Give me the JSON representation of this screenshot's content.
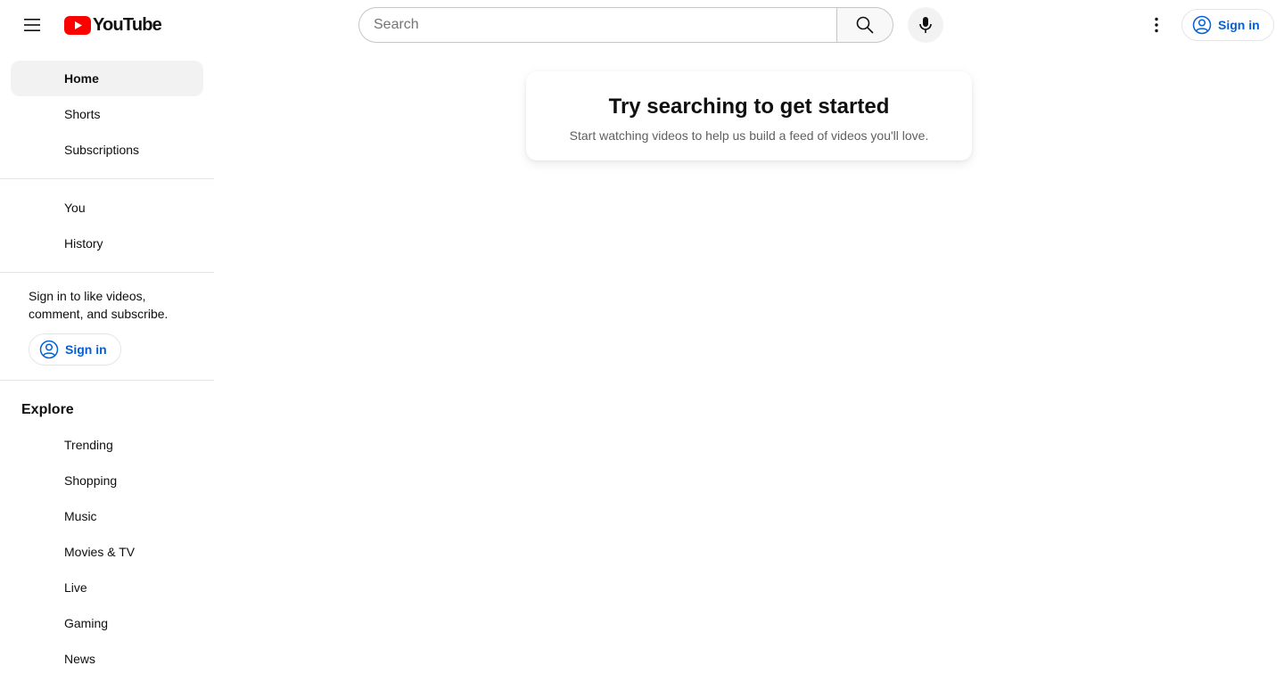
{
  "header": {
    "logo_text": "YouTube",
    "search_placeholder": "Search",
    "signin_label": "Sign in"
  },
  "sidebar": {
    "primary": [
      {
        "label": "Home",
        "active": true
      },
      {
        "label": "Shorts"
      },
      {
        "label": "Subscriptions"
      }
    ],
    "you": [
      {
        "label": "You"
      },
      {
        "label": "History"
      }
    ],
    "signin_prompt": "Sign in to like videos, comment, and subscribe.",
    "signin_label": "Sign in",
    "explore_title": "Explore",
    "explore": [
      {
        "label": "Trending"
      },
      {
        "label": "Shopping"
      },
      {
        "label": "Music"
      },
      {
        "label": "Movies & TV"
      },
      {
        "label": "Live"
      },
      {
        "label": "Gaming"
      },
      {
        "label": "News"
      }
    ]
  },
  "main": {
    "card_title": "Try searching to get started",
    "card_subtitle": "Start watching videos to help us build a feed of videos you'll love."
  },
  "colors": {
    "brand_red": "#ff0000",
    "link_blue": "#065fd4",
    "active_bg": "#f2f2f2"
  },
  "icons": [
    "hamburger-menu-icon",
    "youtube-logo-icon",
    "search-icon",
    "microphone-icon",
    "more-vert-icon",
    "account-circle-icon"
  ]
}
